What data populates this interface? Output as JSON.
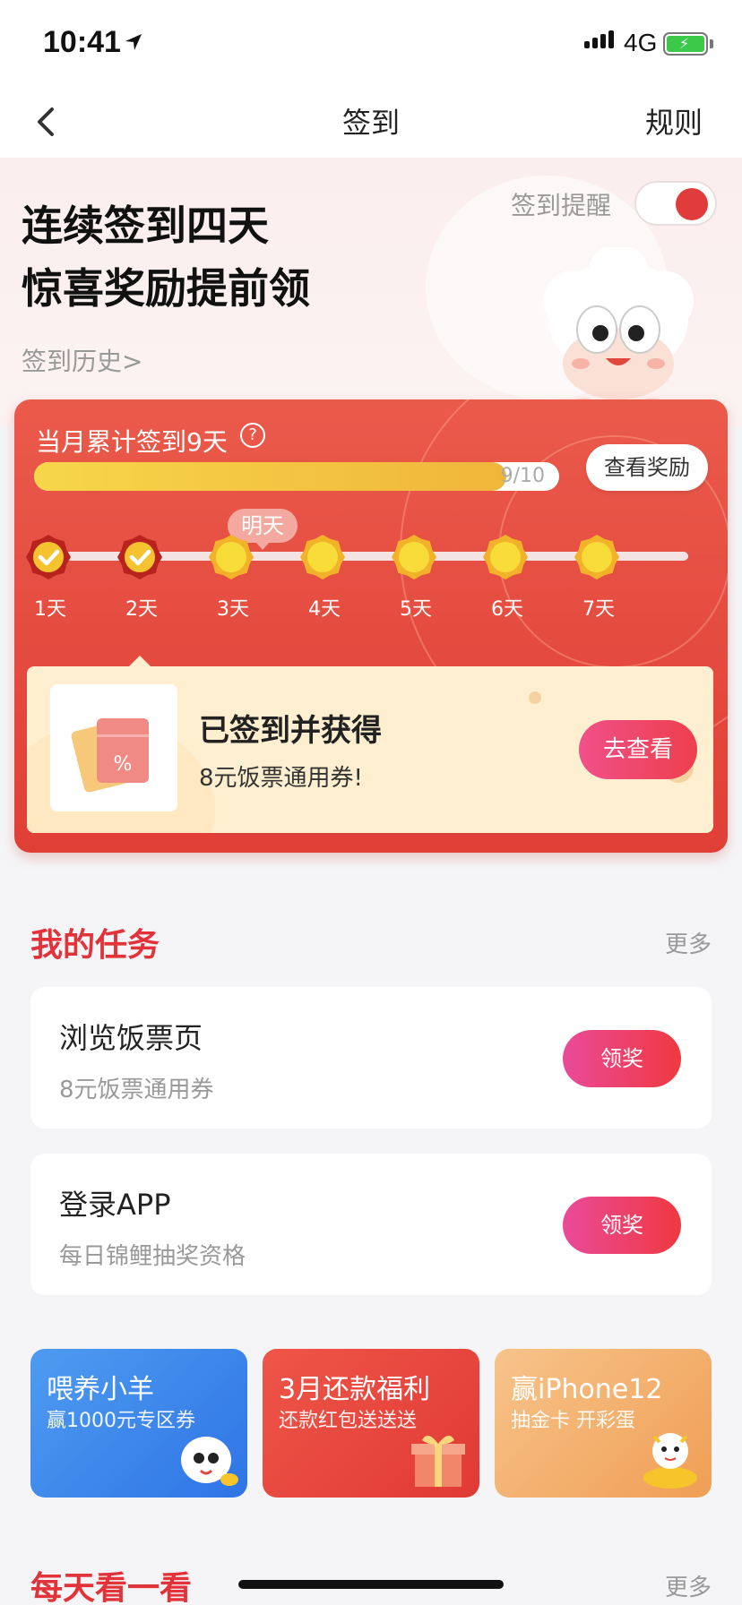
{
  "status_bar": {
    "time": "10:41",
    "network": "4G"
  },
  "nav": {
    "title": "签到",
    "rules": "规则"
  },
  "hero": {
    "title_line1": "连续签到四天",
    "title_line2": "惊喜奖励提前领",
    "history_link": "签到历史>",
    "reminder_label": "签到提醒",
    "reminder_on": true
  },
  "checkin": {
    "summary": "当月累计签到9天",
    "progress_text": "9/10",
    "progress_fraction": 0.9,
    "view_reward_label": "查看奖励",
    "tomorrow_label": "明天",
    "days": [
      {
        "label": "1天",
        "checked": true
      },
      {
        "label": "2天",
        "checked": true
      },
      {
        "label": "3天",
        "checked": false
      },
      {
        "label": "4天",
        "checked": false
      },
      {
        "label": "5天",
        "checked": false
      },
      {
        "label": "6天",
        "checked": false
      },
      {
        "label": "7天",
        "checked": false
      }
    ],
    "reward": {
      "title": "已签到并获得",
      "subtitle": "8元饭票通用券!",
      "button": "去查看"
    }
  },
  "tasks": {
    "title": "我的任务",
    "more": "更多",
    "items": [
      {
        "name": "浏览饭票页",
        "desc": "8元饭票通用券",
        "button": "领奖"
      },
      {
        "name": "登录APP",
        "desc": "每日锦鲤抽奖资格",
        "button": "领奖"
      }
    ]
  },
  "promos": [
    {
      "title": "喂养小羊",
      "subtitle": "赢1000元专区券",
      "color_from": "#4e9cf0",
      "color_to": "#2f74e6"
    },
    {
      "title": "3月还款福利",
      "subtitle": "还款红包送送送",
      "color_from": "#ef5548",
      "color_to": "#e03a35"
    },
    {
      "title": "赢iPhone12",
      "subtitle": "抽金卡 开彩蛋",
      "color_from": "#f7c48a",
      "color_to": "#f09e55"
    }
  ],
  "daily": {
    "title": "每天看一看",
    "more": "更多"
  },
  "colors": {
    "accent": "#e2323a",
    "card_red": "#e6493f",
    "gold": "#f6cf2c"
  }
}
